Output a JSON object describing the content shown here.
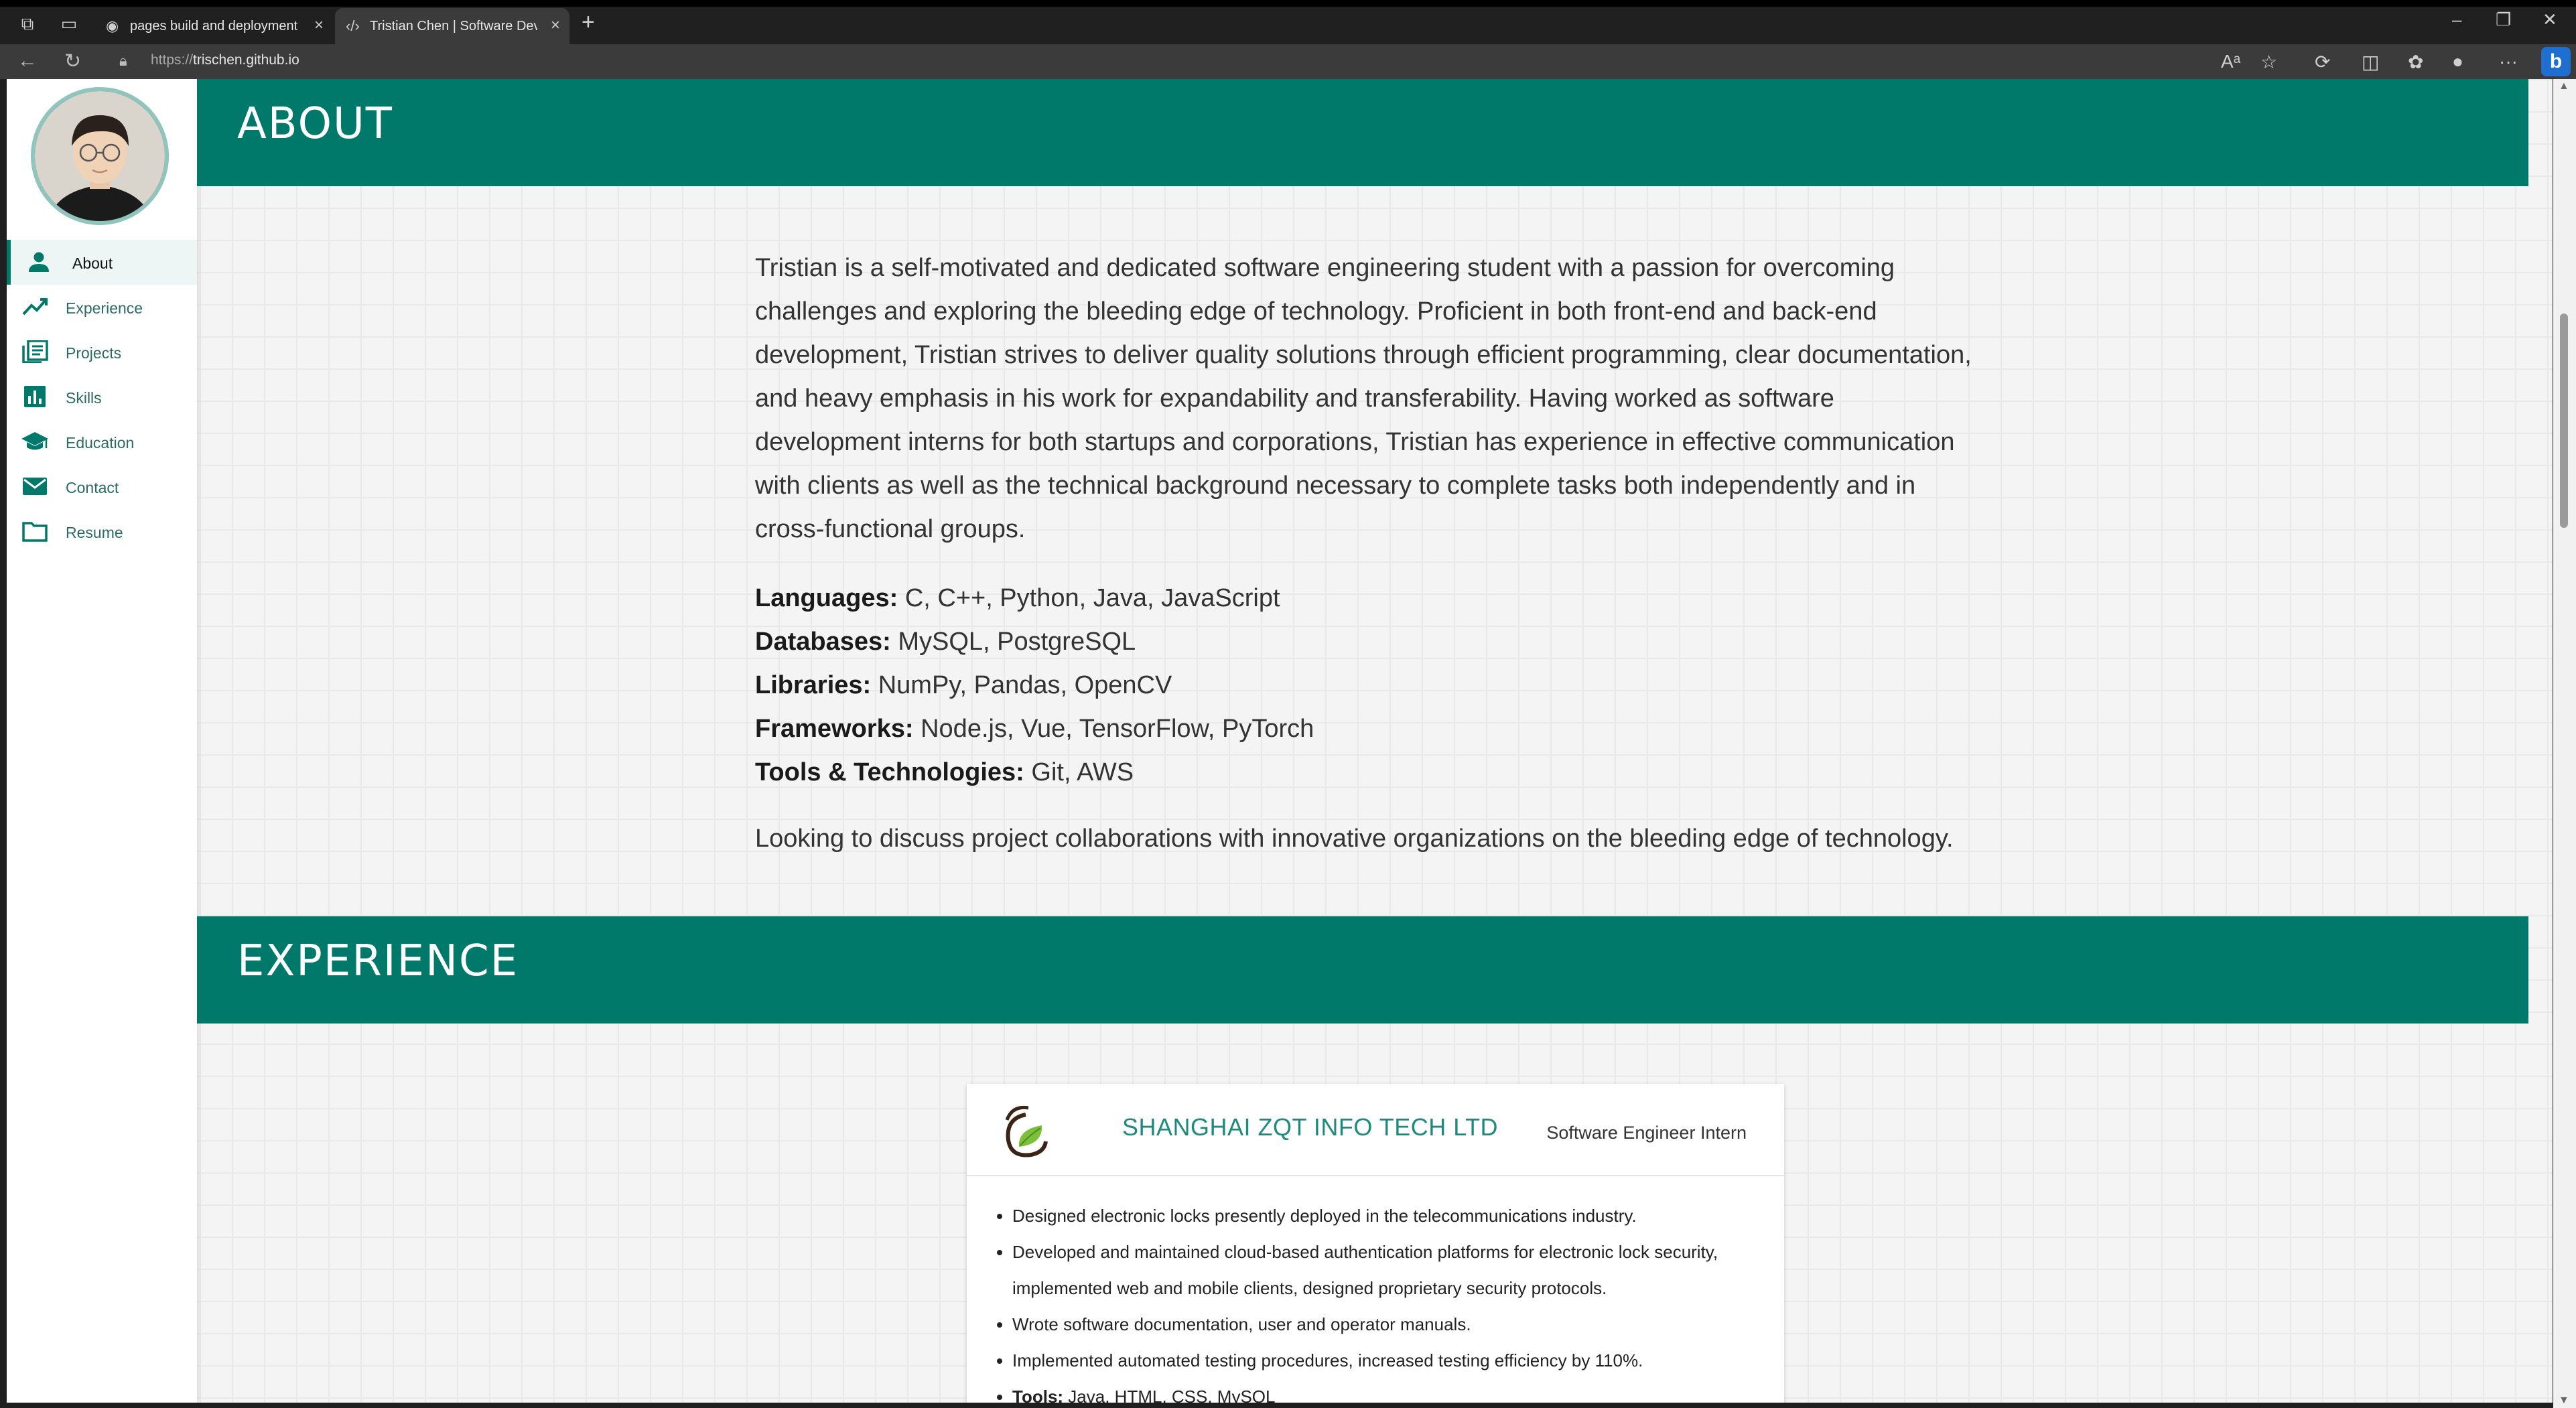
{
  "browser": {
    "tabs": [
      {
        "title": "pages build and deployment · Tr",
        "active": false
      },
      {
        "title": "Tristian Chen | Software Develop",
        "active": true
      }
    ],
    "url_scheme": "https://",
    "url_host": "trischen.github.io"
  },
  "sidebar": {
    "items": [
      {
        "label": "About",
        "icon": "person-icon",
        "active": true
      },
      {
        "label": "Experience",
        "icon": "trending-up-icon"
      },
      {
        "label": "Projects",
        "icon": "list-icon"
      },
      {
        "label": "Skills",
        "icon": "bar-chart-icon"
      },
      {
        "label": "Education",
        "icon": "graduation-cap-icon"
      },
      {
        "label": "Contact",
        "icon": "mail-icon"
      },
      {
        "label": "Resume",
        "icon": "folder-icon"
      }
    ]
  },
  "about": {
    "heading": "ABOUT",
    "bio": "Tristian is a self-motivated and dedicated software engineering student with a passion for overcoming challenges and exploring the bleeding edge of technology. Proficient in both front-end and back-end development, Tristian strives to deliver quality solutions through efficient programming, clear documentation, and heavy emphasis in his work for expandability and transferability. Having worked as software development interns for both startups and corporations, Tristian has experience in effective communication with clients as well as the technical background necessary to complete tasks both independently and in cross-functional groups.",
    "skills": [
      {
        "label": "Languages:",
        "value": "C, C++, Python, Java, JavaScript"
      },
      {
        "label": "Databases:",
        "value": "MySQL, PostgreSQL"
      },
      {
        "label": "Libraries:",
        "value": "NumPy, Pandas, OpenCV"
      },
      {
        "label": "Frameworks:",
        "value": "Node.js, Vue, TensorFlow, PyTorch"
      },
      {
        "label": "Tools & Technologies:",
        "value": "Git, AWS"
      }
    ],
    "closing": "Looking to discuss project collaborations with innovative organizations on the bleeding edge of technology."
  },
  "experience": {
    "heading": "EXPERIENCE",
    "company": "SHANGHAI ZQT INFO TECH LTD",
    "role": "Software Engineer Intern",
    "bullets": [
      "Designed electronic locks presently deployed in the telecommunications industry.",
      "Developed and maintained cloud-based authentication platforms for electronic lock security, implemented web and mobile clients, designed proprietary security protocols.",
      "Wrote software documentation, user and operator manuals.",
      "Implemented automated testing procedures, increased testing efficiency by 110%."
    ],
    "tools_label": "Tools:",
    "tools_value": "Java, HTML, CSS, MySQL"
  },
  "colors": {
    "accent": "#00796b",
    "company": "#1e8a7e"
  }
}
